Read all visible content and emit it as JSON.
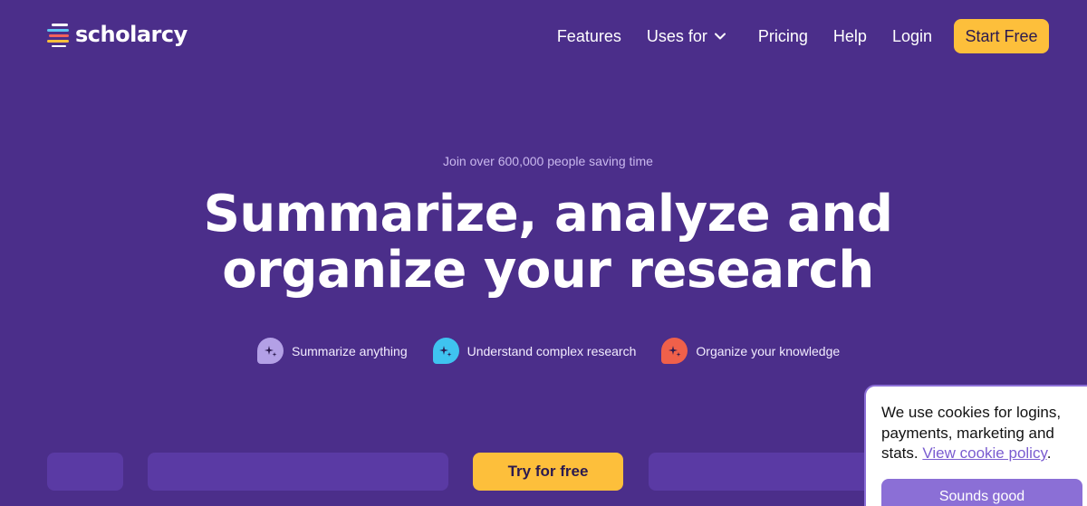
{
  "brand": {
    "name": "scholarcy"
  },
  "nav": {
    "features": "Features",
    "uses_for": "Uses for",
    "pricing": "Pricing",
    "help": "Help",
    "login": "Login",
    "start_free": "Start Free"
  },
  "hero": {
    "tagline": "Join over 600,000 people saving time",
    "headline_line1": "Summarize, analyze and",
    "headline_line2": "organize your research",
    "features": [
      {
        "label": "Summarize anything",
        "icon": "sparkle-bubble-icon",
        "color": "#b3a0e6"
      },
      {
        "label": "Understand complex research",
        "icon": "sparkle-bubble-icon",
        "color": "#3fc3f0"
      },
      {
        "label": "Organize your knowledge",
        "icon": "sparkle-bubble-icon",
        "color": "#f0604a"
      }
    ]
  },
  "cta": {
    "try_label": "Try for free"
  },
  "cookie": {
    "text": "We use cookies for logins, payments, marketing and stats.",
    "link": "View cookie policy",
    "after_link": ".",
    "button": "Sounds good"
  },
  "colors": {
    "background": "#4b2e8a",
    "accent": "#fdbf3b",
    "cookie_accent": "#8b6fd6"
  }
}
